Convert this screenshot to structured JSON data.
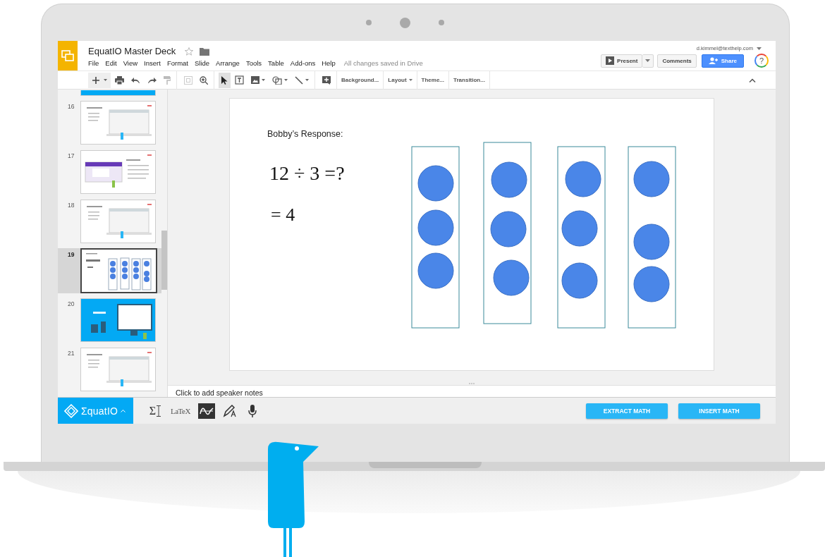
{
  "app": {
    "title": "EquatIO Master Deck",
    "menu": [
      "File",
      "Edit",
      "View",
      "Insert",
      "Format",
      "Slide",
      "Arrange",
      "Tools",
      "Table",
      "Add-ons",
      "Help"
    ],
    "save_status": "All changes saved in Drive",
    "account": "d.kimmel@texthelp.com",
    "help": "?"
  },
  "header_buttons": [
    {
      "label": "Present",
      "kind": "present"
    },
    {
      "label": "Comments",
      "kind": "plain"
    },
    {
      "label": "Share",
      "kind": "share"
    }
  ],
  "toolbar_menus": [
    {
      "label": "Background...",
      "dropdown": false
    },
    {
      "label": "Layout",
      "dropdown": true
    },
    {
      "label": "Theme...",
      "dropdown": false
    },
    {
      "label": "Transition...",
      "dropdown": false
    }
  ],
  "slides": [
    {
      "kind": "blue",
      "cut": true,
      "selected": false
    },
    {
      "number": "16",
      "kind": "laptop",
      "cut": false,
      "selected": false
    },
    {
      "number": "17",
      "kind": "forms",
      "cut": false,
      "selected": false
    },
    {
      "number": "18",
      "kind": "laptop",
      "cut": false,
      "selected": false
    },
    {
      "number": "19",
      "kind": "math",
      "cut": false,
      "selected": true
    },
    {
      "number": "20",
      "kind": "blue",
      "cut": false,
      "selected": false
    },
    {
      "number": "21",
      "kind": "laptop",
      "cut": false,
      "selected": false
    }
  ],
  "slide": {
    "heading": "Bobby’s Response:",
    "equation": "12 ÷ 3 =?",
    "answer": "= 4"
  },
  "speaker_notes": {
    "placeholder": "Click to add speaker notes"
  },
  "equatio": {
    "logo": "ΣquatIO",
    "tools": [
      {
        "kind": "math",
        "label": "Σ",
        "selected": false
      },
      {
        "kind": "latex",
        "label": "LaTeX",
        "selected": false
      },
      {
        "kind": "graph",
        "selected": true
      },
      {
        "kind": "handwriting",
        "selected": false
      },
      {
        "kind": "speech",
        "selected": false
      }
    ],
    "buttons": [
      "EXTRACT MATH",
      "INSERT MATH"
    ]
  }
}
